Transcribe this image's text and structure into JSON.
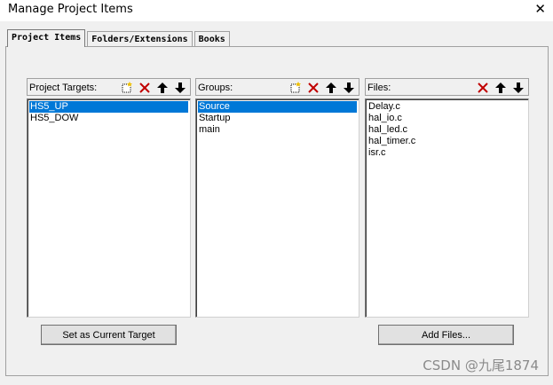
{
  "window": {
    "title": "Manage Project Items",
    "close_glyph": "✕"
  },
  "tabs": [
    {
      "label": "Project Items",
      "active": true
    },
    {
      "label": "Folders/Extensions",
      "active": false
    },
    {
      "label": "Books",
      "active": false
    }
  ],
  "targets": {
    "label": "Project Targets:",
    "items": [
      "HS5_UP",
      "HS5_DOW"
    ],
    "selected": 0,
    "tools": [
      "new-icon",
      "delete-icon",
      "move-up-icon",
      "move-down-icon"
    ]
  },
  "groups": {
    "label": "Groups:",
    "items": [
      "Source",
      "Startup",
      "main"
    ],
    "selected": 0,
    "tools": [
      "new-icon",
      "delete-icon",
      "move-up-icon",
      "move-down-icon"
    ]
  },
  "files": {
    "label": "Files:",
    "items": [
      "Delay.c",
      "hal_io.c",
      "hal_led.c",
      "hal_timer.c",
      "isr.c"
    ],
    "tools": [
      "delete-icon",
      "move-up-icon",
      "move-down-icon"
    ]
  },
  "buttons": {
    "set_target": "Set as Current Target",
    "add_files": "Add Files..."
  },
  "watermark": "CSDN @九尾1874",
  "colors": {
    "selection": "#0078d7",
    "delete_red": "#c00000",
    "panel": "#f0f0f0"
  }
}
